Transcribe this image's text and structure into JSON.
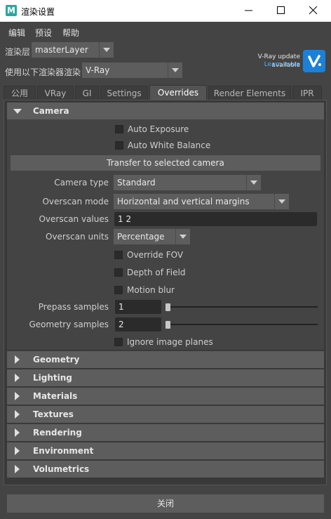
{
  "window": {
    "title": "渲染设置",
    "app_icon": "M"
  },
  "menubar": [
    "编辑",
    "预设",
    "帮助"
  ],
  "render_layer": {
    "label": "渲染层",
    "value": "masterLayer"
  },
  "renderer": {
    "label": "使用以下渲染器渲染",
    "value": "V-Ray"
  },
  "vray_banner": {
    "message": "V-Ray update available",
    "link": "Learn more"
  },
  "tabs": [
    "公用",
    "VRay",
    "GI",
    "Settings",
    "Overrides",
    "Render Elements",
    "IPR"
  ],
  "active_tab": "Overrides",
  "camera_section": {
    "title": "Camera",
    "auto_exposure": "Auto Exposure",
    "auto_white_balance": "Auto White Balance",
    "transfer_button": "Transfer to selected camera",
    "camera_type_label": "Camera type",
    "camera_type_value": "Standard",
    "overscan_mode_label": "Overscan mode",
    "overscan_mode_value": "Horizontal and vertical margins",
    "overscan_values_label": "Overscan values",
    "overscan_values_value": "1 2",
    "overscan_units_label": "Overscan units",
    "overscan_units_value": "Percentage",
    "override_fov": "Override FOV",
    "depth_of_field": "Depth of Field",
    "motion_blur": "Motion blur",
    "prepass_samples_label": "Prepass samples",
    "prepass_samples_value": "1",
    "geometry_samples_label": "Geometry samples",
    "geometry_samples_value": "2",
    "ignore_image_planes": "Ignore image planes"
  },
  "collapsed_sections": [
    "Geometry",
    "Lighting",
    "Materials",
    "Textures",
    "Rendering",
    "Environment",
    "Volumetrics"
  ],
  "close_button": "关闭",
  "colors": {
    "vray_blue": "#1c80d7",
    "link_blue": "#4fb0ff",
    "app_teal": "#2aa7a1"
  }
}
